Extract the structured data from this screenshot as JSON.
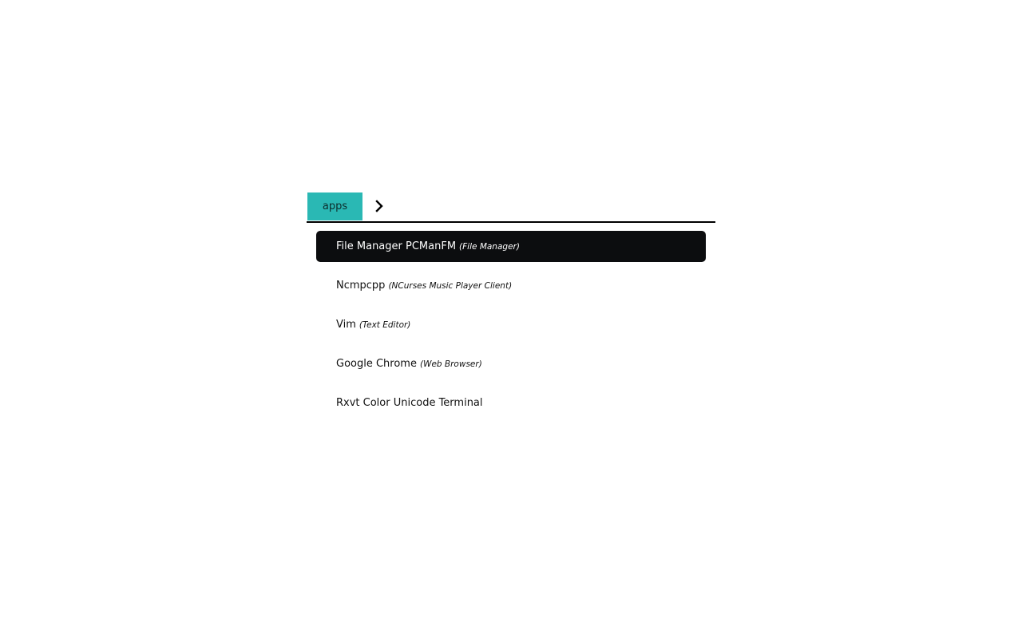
{
  "prompt": {
    "label": "apps",
    "color": "#2ab8b4"
  },
  "input": {
    "value": "",
    "caret_icon": "chevron-right-icon"
  },
  "results": [
    {
      "name": "File Manager PCManFM",
      "description": "(File Manager)",
      "selected": true
    },
    {
      "name": "Ncmpcpp",
      "description": "(NCurses Music Player Client)",
      "selected": false
    },
    {
      "name": "Vim",
      "description": "(Text Editor)",
      "selected": false
    },
    {
      "name": "Google Chrome",
      "description": "(Web Browser)",
      "selected": false
    },
    {
      "name": "Rxvt Color Unicode Terminal",
      "description": "",
      "selected": false
    }
  ],
  "colors": {
    "selected_background": "#0c0d0f",
    "selected_text": "#ffffff"
  }
}
